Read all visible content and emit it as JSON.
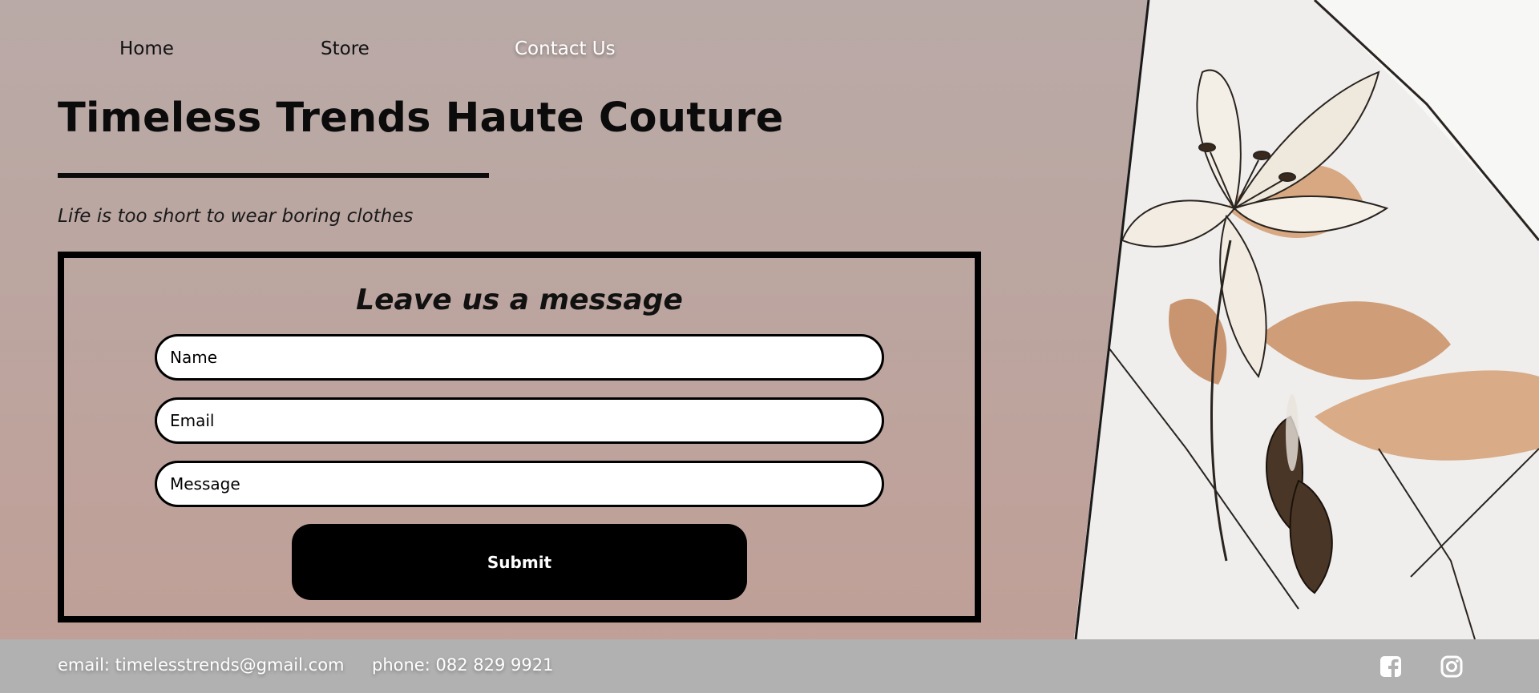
{
  "nav": {
    "home": "Home",
    "store": "Store",
    "contact": "Contact Us"
  },
  "brand": {
    "title": "Timeless Trends Haute Couture",
    "tagline": "Life is too short to wear boring clothes"
  },
  "form": {
    "heading": "Leave us a message",
    "name_placeholder": "Name",
    "email_placeholder": "Email",
    "message_placeholder": "Message",
    "submit_label": "Submit"
  },
  "footer": {
    "email": "email: timelesstrends@gmail.com",
    "phone": "phone: 082 829 9921",
    "icons": [
      "facebook-icon",
      "instagram-icon"
    ]
  },
  "colors": {
    "background_top": "#b9aaa7",
    "background_bottom": "#c09f96",
    "footer": "#b1b1b1",
    "accent": "#000000"
  }
}
